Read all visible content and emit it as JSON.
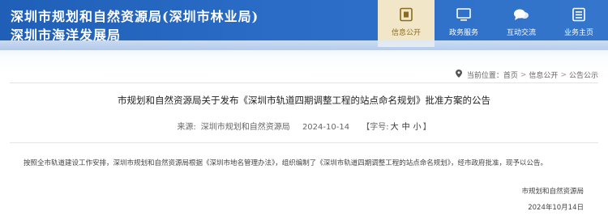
{
  "header": {
    "title_line1": "深圳市规划和自然资源局(深圳市林业局)",
    "title_line2": "深圳市海洋发展局",
    "nav": [
      {
        "label": "信息公开",
        "icon": "info-doc-icon",
        "active": true
      },
      {
        "label": "政务服务",
        "icon": "monitor-icon",
        "active": false
      },
      {
        "label": "互动交流",
        "icon": "chat-bubble-icon",
        "active": false
      },
      {
        "label": "业务主页",
        "icon": "business-list-icon",
        "active": false
      }
    ],
    "colors": {
      "bar": "#2a6cc6",
      "active_tab": "#f1e7c8"
    }
  },
  "breadcrumb": {
    "prefix": "当前位置：",
    "items": [
      "首页",
      "信息公开",
      "公告公示"
    ],
    "separator": ">"
  },
  "article": {
    "title": "市规划和自然资源局关于发布《深圳市轨道四期调整工程的站点命名规划》批准方案的公告",
    "source_label": "来源:",
    "source": "深圳市规划和自然资源局",
    "date": "2024-10-14",
    "font_size_prefix": "【字号:",
    "size_large": "大",
    "size_medium": "中",
    "size_small": "小",
    "font_size_suffix": "】",
    "body": "按照全市轨道建设工作安排，深圳市规划和自然资源局根据《深圳市地名管理办法》，组织编制了《深圳市轨道四期调整工程的站点命名规划》，经市政府批准，现予以公告。",
    "signature": "市规划和自然资源局",
    "signature_date": "2024年10月14日"
  }
}
